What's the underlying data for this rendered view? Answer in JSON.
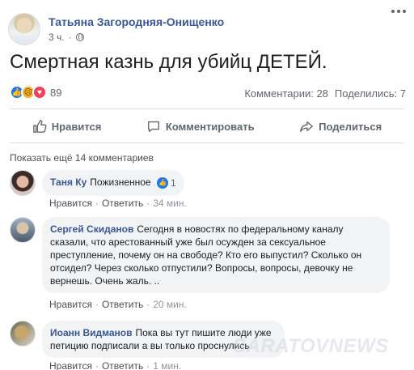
{
  "post": {
    "author": "Татьяна Загородняя-Онищенко",
    "time": "3 ч.",
    "text": "Смертная казнь для убийц ДЕТЕЙ.",
    "reactions_count": "89",
    "comments_count": "Комментарии: 28",
    "shares_count": "Поделились: 7",
    "reaction_icons": [
      "like",
      "sad",
      "love"
    ]
  },
  "actions": {
    "like": "Нравится",
    "comment": "Комментировать",
    "share": "Поделиться"
  },
  "show_more": "Показать ещё 14 комментариев",
  "comments": [
    {
      "name": "Таня Ку",
      "text": "Пожизненное",
      "likes": "1",
      "like_label": "Нравится",
      "reply_label": "Ответить",
      "time": "34 мин."
    },
    {
      "name": "Сергей Скиданов",
      "text": "Сегодня в новостях по федеральному каналу сказали, что арестованный уже был осужден за сексуальное преступление, почему он на свободе? Кто его выпустил? Сколько он отсидел? Через сколько отпустили? Вопросы, вопросы, девочку не вернешь. Очень жаль. ..",
      "like_label": "Нравится",
      "reply_label": "Ответить",
      "time": "20 мин."
    },
    {
      "name": "Иоанн Видманов",
      "text": "Пока вы тут пишите люди уже петицию подписали а вы только проснулись",
      "like_label": "Нравится",
      "reply_label": "Ответить",
      "time": "1 мин."
    }
  ],
  "watermark": "SARATOVNEWS",
  "colors": {
    "link": "#385898",
    "like_blue": "#1877f2",
    "love_red": "#f33e58",
    "sad_yellow": "#f7b125",
    "bubble": "#f2f3f5"
  }
}
